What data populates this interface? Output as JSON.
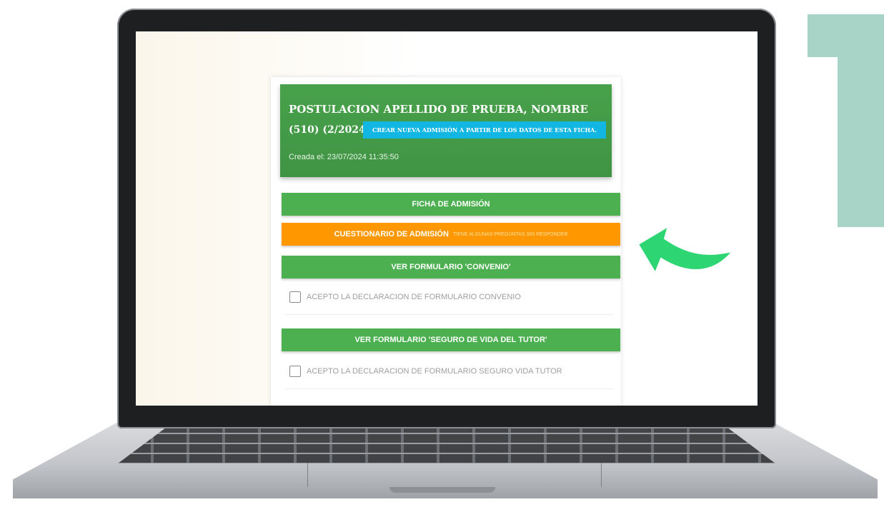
{
  "form": {
    "title": "POSTULACION APELLIDO DE PRUEBA, NOMBRE",
    "id": "(510) (2/2024)",
    "new_admission_button": "CREAR NUEVA ADMISIÓN A PARTIR DE LOS DATOS DE ESTA FICHA.",
    "created": "Creada el: 23/07/2024 11:35:50"
  },
  "buttons": {
    "admission_form": "FICHA DE ADMISIÓN",
    "questionnaire": "CUESTIONARIO DE ADMISIÓN",
    "questionnaire_warning": "TIENE ALGUNAS PREGUNTAS SIN RESPONDER",
    "agreement_form": "VER FORMULARIO 'CONVENIO'",
    "insurance_form": "VER FORMULARIO 'SEGURO DE VIDA DEL TUTOR'"
  },
  "checkboxes": {
    "agreement": "ACEPTO LA DECLARACION DE FORMULARIO CONVENIO",
    "insurance": "ACEPTO LA DECLARACION DE FORMULARIO SEGURO VIDA TUTOR"
  },
  "colors": {
    "header_green": "#43a047",
    "button_green": "#4caf50",
    "button_orange": "#ff9800",
    "accent_cyan": "#12b6e3",
    "arrow_green": "#2ed573",
    "deco_teal": "#a8d4c8"
  },
  "icons": [
    "checkbox-icon",
    "pointer-arrow-icon"
  ]
}
